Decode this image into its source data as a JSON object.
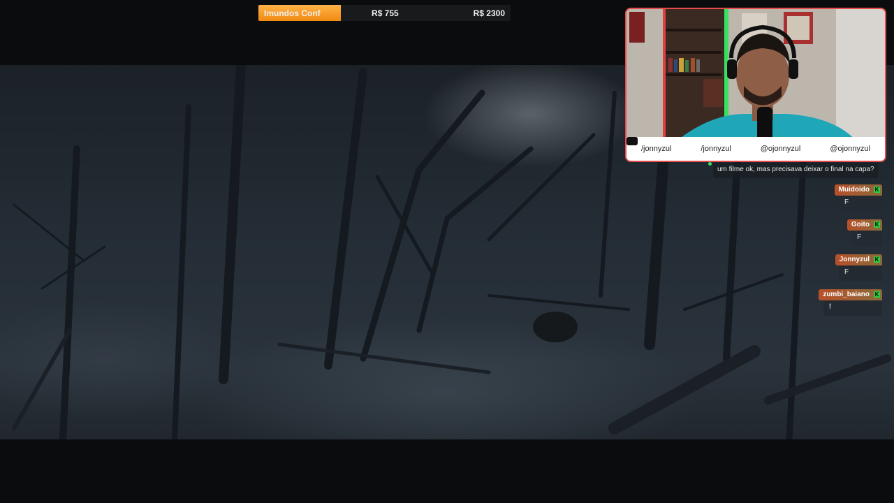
{
  "goal": {
    "name": "Imundos Conf",
    "current": "R$ 755",
    "target": "R$ 2300",
    "progress": 0.328,
    "fill_color": "#f39a1e"
  },
  "webcam": {
    "border_color": "#e84b4b",
    "socials": [
      {
        "icon": "youtube-icon",
        "handle": "/jonnyzul"
      },
      {
        "icon": "facebook-icon",
        "handle": "/jonnyzul"
      },
      {
        "icon": "twitter-icon",
        "handle": "@ojonnyzul"
      },
      {
        "icon": "instagram-icon",
        "handle": "@ojonnyzul"
      }
    ]
  },
  "chat": {
    "top_message": "um filme ok, mas precisava deixar o final na capa?",
    "messages": [
      {
        "user": "Muidoido",
        "text": "F"
      },
      {
        "user": "Goito",
        "text": "F"
      },
      {
        "user": "Jonnyzul",
        "text": "F"
      },
      {
        "user": "zumbi_baiano",
        "text": "f"
      }
    ],
    "badge": "K"
  }
}
